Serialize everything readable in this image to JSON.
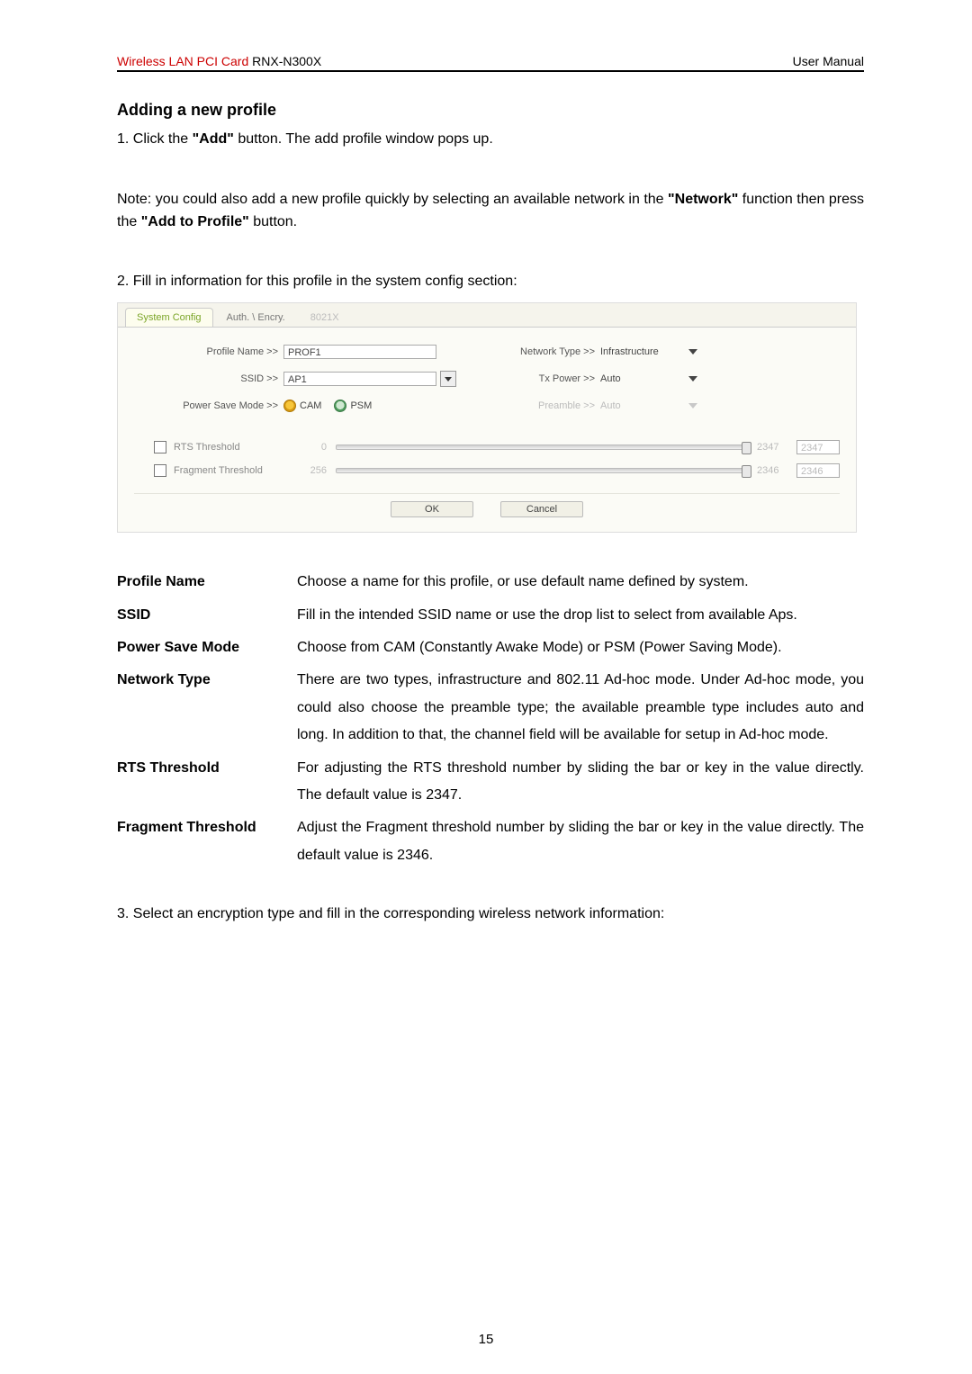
{
  "header": {
    "product_line": "Wireless LAN PCI Card",
    "model": "RNX-N300X",
    "doc_type": "User Manual"
  },
  "section_title": "Adding a new profile",
  "step1_prefix": "1. Click the ",
  "step1_bold": "\"Add\"",
  "step1_suffix": " button. The add profile window pops up.",
  "note_p1": "Note: you could also add a new profile quickly by selecting an available network in the ",
  "note_b1": "\"Network\"",
  "note_p2": " function then press the ",
  "note_b2": "\"Add to Profile\"",
  "note_p3": " button.",
  "step2": "2. Fill in information for this profile in the system config section:",
  "shot": {
    "tabs": {
      "active": "System Config",
      "t2": "Auth. \\ Encry.",
      "t3": "8021X"
    },
    "labels": {
      "profile_name": "Profile Name >>",
      "ssid": "SSID >>",
      "power_save": "Power Save Mode >>",
      "network_type": "Network Type >>",
      "tx_power": "Tx Power >>",
      "preamble": "Preamble >>",
      "rts": "RTS Threshold",
      "frag": "Fragment Threshold"
    },
    "values": {
      "profile_name": "PROF1",
      "ssid": "AP1",
      "psm_cam": "CAM",
      "psm_psm": "PSM",
      "network_type": "Infrastructure",
      "tx_power": "Auto",
      "preamble": "Auto",
      "rts_min": "0",
      "rts_max": "2347",
      "rts_val": "2347",
      "frag_min": "256",
      "frag_max": "2346",
      "frag_val": "2346"
    },
    "buttons": {
      "ok": "OK",
      "cancel": "Cancel"
    }
  },
  "defs": [
    {
      "term": "Profile Name",
      "text": "Choose a name for this profile, or use default name defined by system."
    },
    {
      "term": "SSID",
      "text": "Fill in the intended SSID name or use the drop list to select from available Aps."
    },
    {
      "term": "Power Save Mode",
      "text": "Choose from CAM (Constantly Awake Mode) or PSM (Power Saving Mode)."
    },
    {
      "term": "Network Type",
      "text": "There are two types, infrastructure and 802.11 Ad-hoc mode. Under Ad-hoc mode, you could also choose the preamble type; the available preamble type includes auto and long. In addition to that, the channel field will be available for setup in Ad-hoc mode."
    },
    {
      "term": "RTS Threshold",
      "text": "For adjusting the RTS threshold number by sliding the bar or key in the value directly. The default value is 2347."
    },
    {
      "term": "Fragment Threshold",
      "text": "Adjust the Fragment threshold number by sliding the bar or key in the value directly. The default value is 2346."
    }
  ],
  "step3": "3. Select an encryption type and fill in the corresponding wireless network information:",
  "page_number": "15"
}
